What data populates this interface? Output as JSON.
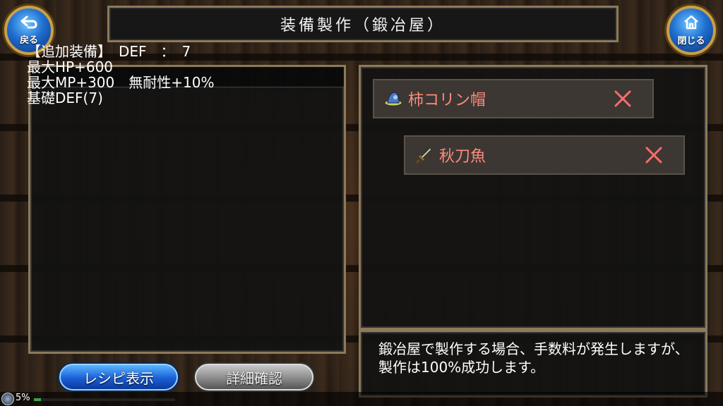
{
  "header": {
    "title": "装備製作（鍛冶屋）",
    "back_label": "戻る",
    "close_label": "閉じる"
  },
  "description": {
    "lines": "【追加装備】　DEF　：　7\n最大HP+600\n最大MP+300　無耐性+10%\n基礎DEF(7)"
  },
  "materials": [
    {
      "name": "柿コリン帽",
      "icon": "hat-icon",
      "color": "#ff8a7a"
    },
    {
      "name": "秋刀魚",
      "icon": "sword-icon",
      "color": "#ff8a7a"
    }
  ],
  "message": "鍛冶屋で製作する場合、手数料が発生しますが、製作は100%成功します。",
  "buttons": {
    "recipe_label": "レシピ表示",
    "detail_label": "詳細確認"
  },
  "status": {
    "percent_label": "5%",
    "progress": 0.05
  },
  "colors": {
    "accent_blue": "#1f6fd0",
    "item_text": "#ff8a7a",
    "remove_x": "#ff6b6b",
    "frame_gold": "#8c7a5a"
  }
}
